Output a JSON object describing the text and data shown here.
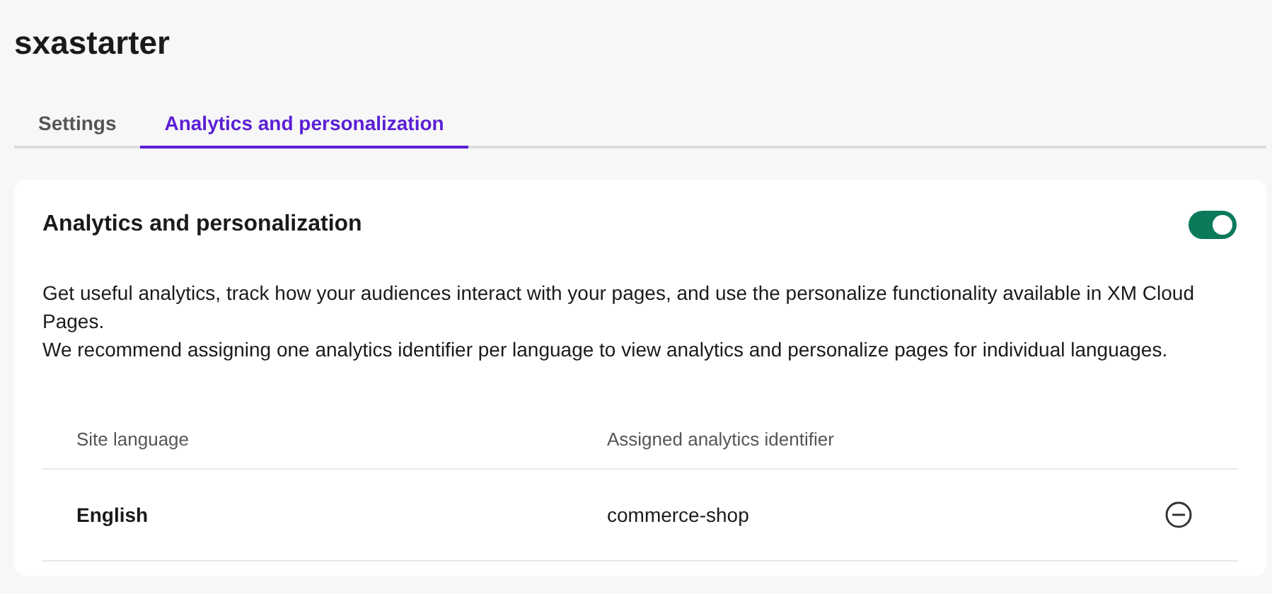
{
  "page": {
    "title": "sxastarter"
  },
  "tabs": [
    {
      "label": "Settings",
      "selected": false
    },
    {
      "label": "Analytics and personalization",
      "selected": true
    }
  ],
  "card": {
    "title": "Analytics and personalization",
    "toggle": {
      "on": true
    },
    "paragraphs": [
      "Get useful analytics, track how your audiences interact with your pages, and use the personalize functionality available in XM Cloud Pages.",
      "We recommend assigning one analytics identifier per language to view analytics and personalize pages for individual languages."
    ]
  },
  "table": {
    "columns": [
      "Site language",
      "Assigned analytics identifier"
    ],
    "rows": [
      {
        "language": "English",
        "identifier": "commerce-shop"
      }
    ]
  }
}
